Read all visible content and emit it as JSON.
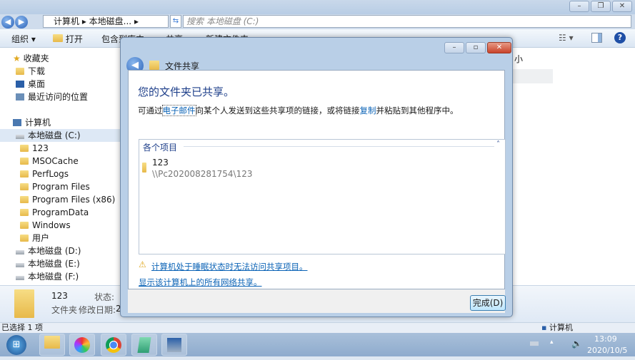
{
  "explorer": {
    "address": {
      "crumbs": [
        "计算机",
        "本地磁盘..."
      ],
      "search_placeholder": "搜索 本地磁盘 (C:)"
    },
    "toolbar": {
      "organize": "组织 ▾",
      "open": "打开",
      "include": "包含到库中",
      "share": "共享",
      "new_folder": "新建文件夹"
    },
    "column_fragment": "小",
    "sidebar": {
      "favorites": "收藏夹",
      "favorites_items": [
        "下载",
        "桌面",
        "最近访问的位置"
      ],
      "computer": "计算机",
      "drive_c": "本地磁盘 (C:)",
      "folders": [
        "123",
        "MSOCache",
        "PerfLogs",
        "Program Files",
        "Program Files (x86)",
        "ProgramData",
        "Windows",
        "用户"
      ],
      "drives": [
        "本地磁盘 (D:)",
        "本地磁盘 (E:)",
        "本地磁盘 (F:)"
      ]
    },
    "details": {
      "name": "123",
      "type": "文件夹",
      "state_label": "状态:",
      "modified_label": "修改日期:",
      "modified_fragment": "2"
    },
    "status": {
      "selected": "已选择 1 项",
      "location": "计算机"
    }
  },
  "dialog": {
    "title": "文件共享",
    "heading": "您的文件夹已共享。",
    "desc_before": "可通过",
    "desc_email": "电子邮件",
    "desc_middle": "向某个人发送到这些共享项的链接，或将链接",
    "desc_copy": "复制",
    "desc_after": "并粘贴到其他程序中。",
    "group_label": "各个项目",
    "item": {
      "name": "123",
      "path": "\\\\Pc202008281754\\123"
    },
    "warning_link": "计算机处于睡眠状态时无法访问共享项目。",
    "show_all_link": "显示该计算机上的所有网络共享。",
    "done_button": "完成(D)"
  },
  "taskbar": {
    "time": "13:09",
    "date": "2020/10/5"
  }
}
